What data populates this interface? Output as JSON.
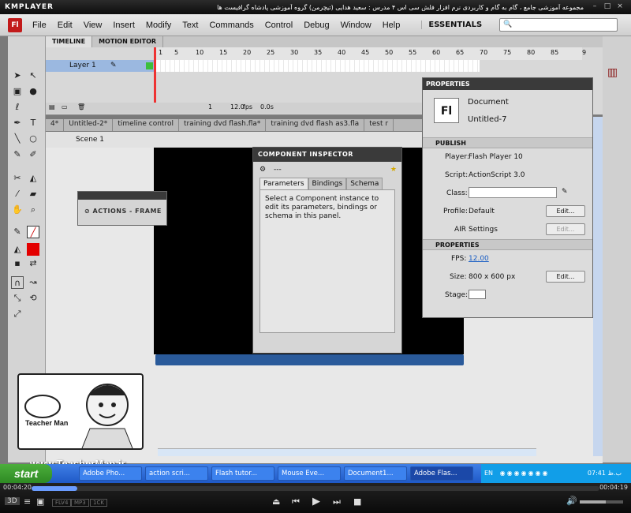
{
  "player": {
    "logo": "KMPLAYER",
    "title": "مجموعه آموزشی جامع ، گام به گام و کاربردی نرم افزار فلش سی اس ۴ مدرس : سعید هدایی (تیچرمن) گروه آموزشی پادشاه گرافیست ها",
    "time_current": "00:04:20",
    "time_total": "00:04:19",
    "format_badges": [
      "FLV4",
      "MP3",
      "1CK"
    ]
  },
  "app": {
    "logo": "Fl",
    "menu": [
      "File",
      "Edit",
      "View",
      "Insert",
      "Modify",
      "Text",
      "Commands",
      "Control",
      "Debug",
      "Window",
      "Help"
    ],
    "workspace": "ESSENTIALS",
    "search_placeholder": "🔍"
  },
  "timeline": {
    "tabs": [
      "TIMELINE",
      "MOTION EDITOR"
    ],
    "layer": "Layer 1",
    "ruler": [
      "1",
      "5",
      "10",
      "15",
      "20",
      "25",
      "30",
      "35",
      "40",
      "45",
      "50",
      "55",
      "60",
      "65",
      "70",
      "75",
      "80",
      "85",
      "9"
    ],
    "frame": "1",
    "fps": "12.0",
    "fps_unit": "fps",
    "time": "0.0s"
  },
  "doctabs": [
    "4*",
    "Untitled-2*",
    "timeline control",
    "training dvd flash.fla*",
    "training dvd flash as3.fla",
    "test r"
  ],
  "scene": "Scene 1",
  "actions_panel": {
    "title": "ACTIONS - FRAME"
  },
  "component_inspector": {
    "title": "COMPONENT INSPECTOR",
    "row": "---",
    "tabs": [
      "Parameters",
      "Bindings",
      "Schema"
    ],
    "message": "Select a Component instance to edit its parameters, bindings or schema in this panel."
  },
  "properties": {
    "title": "PROPERTIES",
    "doc_type": "Document",
    "doc_name": "Untitled-7",
    "publish_header": "PUBLISH",
    "player_label": "Player:",
    "player_value": "Flash Player 10",
    "script_label": "Script:",
    "script_value": "ActionScript 3.0",
    "class_label": "Class:",
    "profile_label": "Profile:",
    "profile_value": "Default",
    "edit_label": "Edit...",
    "air_label": "AIR",
    "air_settings": "Settings",
    "props_header": "PROPERTIES",
    "fps_label": "FPS:",
    "fps_value": "12.00",
    "size_label": "Size:",
    "size_value": "800 x 600 px",
    "stage_label": "Stage:"
  },
  "watermark": {
    "url": "www.TeacherMan.ir",
    "card_text": "Teacher Man"
  },
  "taskbar": {
    "start": "start",
    "items": [
      "Adobe Pho...",
      "action scri...",
      "Flash tutor...",
      "Mouse Eve...",
      "Document1...",
      "Adobe Flas..."
    ],
    "lang": "EN",
    "clock": "07:41 ب.ظ"
  }
}
